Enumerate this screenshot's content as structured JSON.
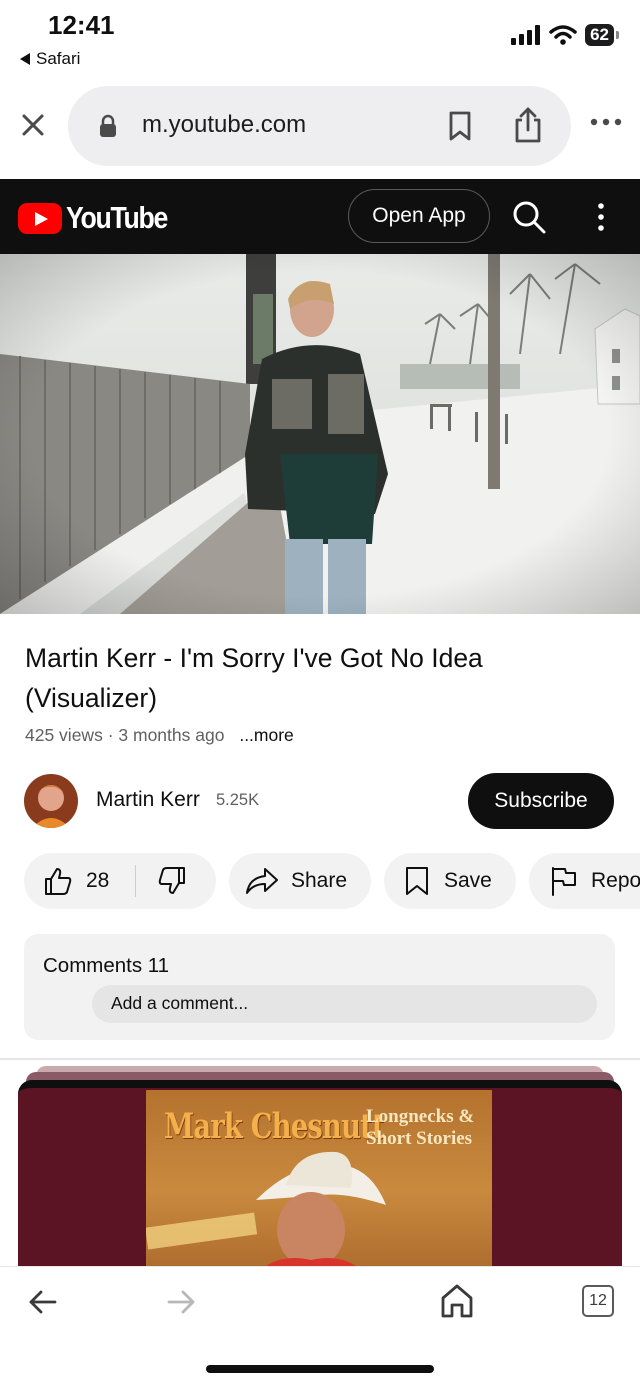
{
  "status_bar": {
    "time": "12:41",
    "back_app": "Safari",
    "battery": "62",
    "icons": [
      "signal-icon",
      "wifi-icon",
      "battery-icon"
    ]
  },
  "browser": {
    "url": "m.youtube.com",
    "icons": [
      "close-icon",
      "lock-icon",
      "bookmark-icon",
      "share-icon",
      "more-icon"
    ]
  },
  "youtube_header": {
    "logo_text": "YouTube",
    "open_app_label": "Open App",
    "icons": [
      "search-icon",
      "kebab-menu-icon"
    ],
    "brand_red": "#ff0000"
  },
  "video": {
    "title": "Martin Kerr - I'm Sorry I've Got No Idea (Visualizer)",
    "views": "425 views",
    "uploaded": "3 months ago",
    "more_label": "...more"
  },
  "channel": {
    "name": "Martin Kerr",
    "subscribers": "5.25K",
    "subscribe_label": "Subscribe"
  },
  "actions": {
    "like_count": "28",
    "share_label": "Share",
    "save_label": "Save",
    "report_label": "Report",
    "icons": [
      "thumbs-up-icon",
      "thumbs-down-icon",
      "share-arrow-icon",
      "bookmark-outline-icon",
      "flag-icon"
    ]
  },
  "comments": {
    "title": "Comments 11",
    "placeholder": "Add a comment..."
  },
  "next_video": {
    "album_artist": "Mark Chesnutt",
    "album_title_line1": "Longnecks &",
    "album_title_line2": "Short Stories"
  },
  "bottom_bar": {
    "tab_count": "12",
    "icons": [
      "back-arrow-icon",
      "forward-arrow-icon",
      "home-icon",
      "tabs-icon"
    ]
  }
}
